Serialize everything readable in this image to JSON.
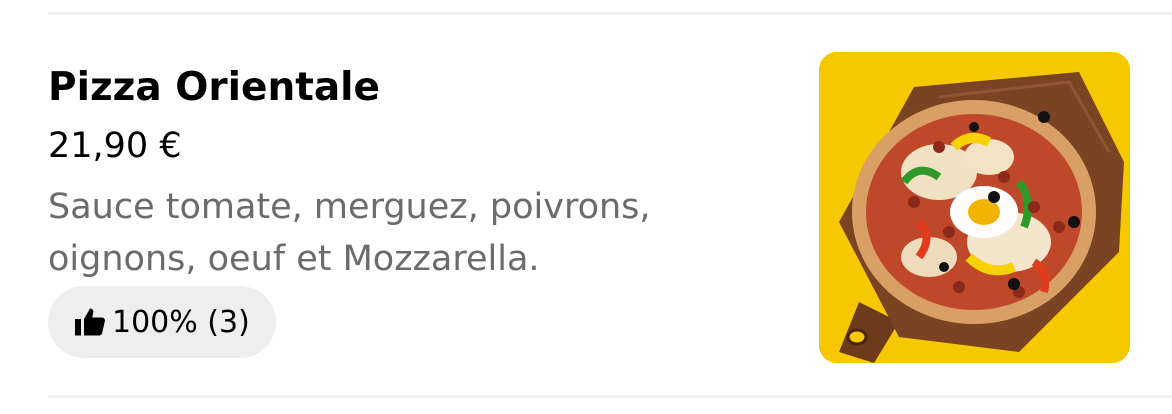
{
  "item": {
    "title": "Pizza Orientale",
    "price": "21,90 €",
    "description": "Sauce tomate, merguez, poivrons, oignons, oeuf et Mozzarella.",
    "rating": {
      "icon": "thumbs-up-icon",
      "text": "100% (3)"
    },
    "image": {
      "background_color": "#f6c800",
      "subject": "pizza on wooden board"
    }
  },
  "colors": {
    "title": "#000000",
    "description": "#6b6b6b",
    "pill_background": "#eeeeee",
    "divider": "#f0f0f0"
  }
}
